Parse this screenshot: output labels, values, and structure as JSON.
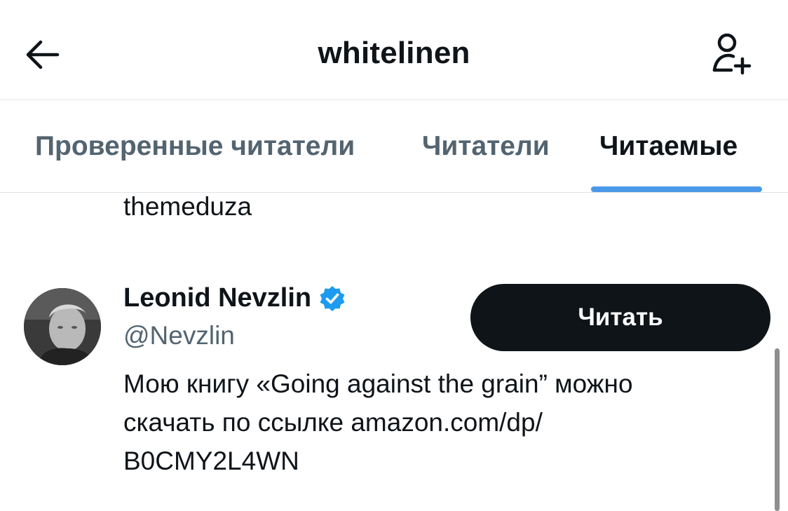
{
  "header": {
    "title": "whitelinen",
    "back_icon": "arrow-left-icon",
    "add_user_icon": "person-add-icon"
  },
  "tabs": [
    {
      "label": "Проверенные читатели",
      "active": false
    },
    {
      "label": "Читатели",
      "active": false
    },
    {
      "label": "Читаемые",
      "active": true
    }
  ],
  "list": {
    "previous_bio_fragment": "themeduza",
    "user": {
      "name": "Leonid Nevzlin",
      "handle": "@Nevzlin",
      "verified": true,
      "follow_label": "Читать",
      "bio_lines": [
        "Мою книгу «Going against the grain” можно",
        "скачать по ссылке amazon.com/dp/",
        "B0CMY2L4WN"
      ]
    }
  },
  "colors": {
    "text_primary": "#0f1419",
    "text_secondary": "#536471",
    "accent": "#4a99e9",
    "verified_badge": "#1d9bf0",
    "button_bg": "#0f1419",
    "button_text": "#ffffff"
  }
}
